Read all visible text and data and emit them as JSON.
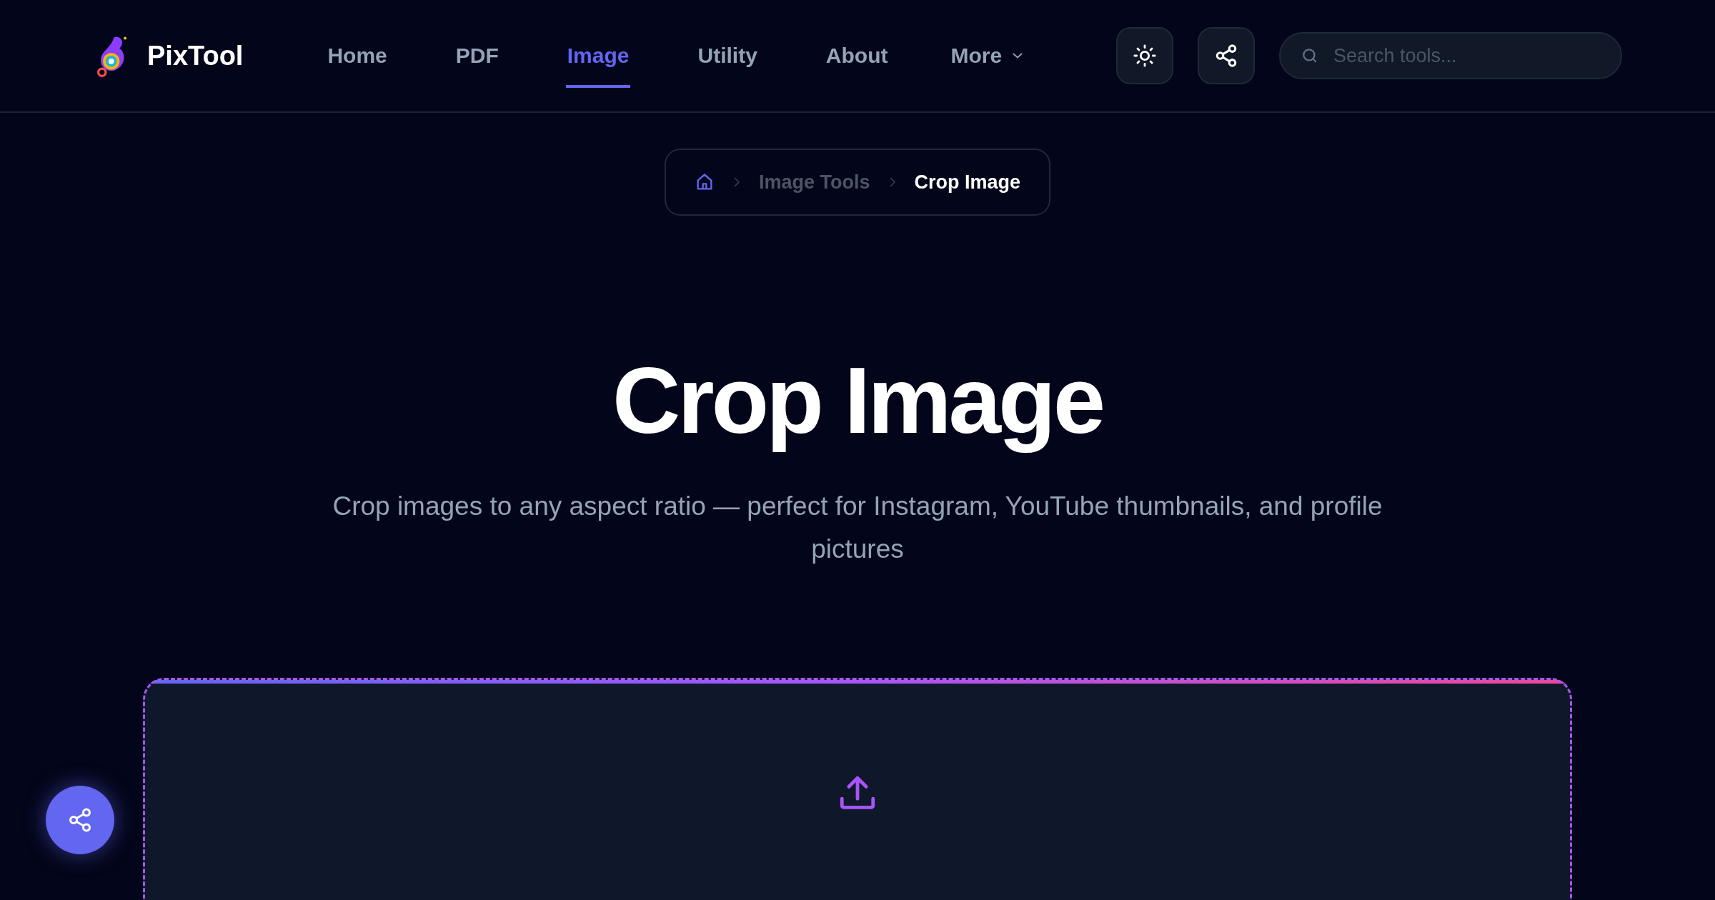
{
  "header": {
    "brand": "PixTool",
    "nav": [
      {
        "label": "Home",
        "selected": false
      },
      {
        "label": "PDF",
        "selected": false
      },
      {
        "label": "Image",
        "selected": true
      },
      {
        "label": "Utility",
        "selected": false
      },
      {
        "label": "About",
        "selected": false
      }
    ],
    "more": "More",
    "search": {
      "placeholder": "Search tools..."
    }
  },
  "breadcrumb": {
    "items": [
      "Image Tools",
      "Crop Image"
    ]
  },
  "hero": {
    "title": "Crop Image",
    "subtitle": "Crop images to any aspect ratio — perfect for Instagram, YouTube thumbnails, and profile pictures"
  }
}
